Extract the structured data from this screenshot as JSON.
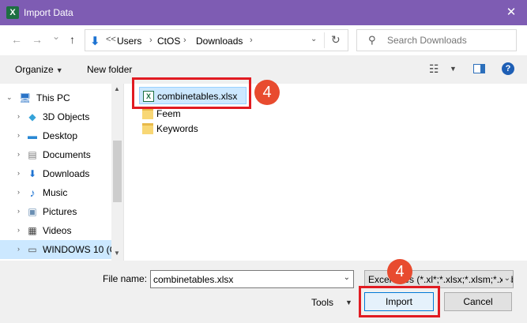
{
  "window": {
    "title": "Import Data",
    "app_icon": "excel-icon",
    "close_glyph": "✕"
  },
  "nav": {
    "back_glyph": "←",
    "forward_glyph": "→",
    "recent_glyph": "⌄",
    "up_glyph": "↑",
    "address": {
      "overflow": "<<",
      "crumbs": [
        "Users",
        "CtOS",
        "Downloads"
      ],
      "separator": "›",
      "refresh_glyph": "↻"
    },
    "search": {
      "placeholder": "Search Downloads",
      "icon": "search-icon"
    }
  },
  "toolbar": {
    "organize_label": "Organize",
    "new_folder_label": "New folder",
    "help_glyph": "?"
  },
  "sidebar": {
    "items": [
      {
        "label": "This PC",
        "icon": "computer-icon",
        "glyph": "🖥"
      },
      {
        "label": "3D Objects",
        "icon": "cube-icon",
        "glyph": "◆"
      },
      {
        "label": "Desktop",
        "icon": "desktop-icon",
        "glyph": "▬"
      },
      {
        "label": "Documents",
        "icon": "document-icon",
        "glyph": "▤"
      },
      {
        "label": "Downloads",
        "icon": "download-icon",
        "glyph": "⬇"
      },
      {
        "label": "Music",
        "icon": "music-icon",
        "glyph": "♪"
      },
      {
        "label": "Pictures",
        "icon": "picture-icon",
        "glyph": "▣"
      },
      {
        "label": "Videos",
        "icon": "video-icon",
        "glyph": "▦"
      },
      {
        "label": "WINDOWS 10 (C",
        "icon": "drive-icon",
        "glyph": "▭"
      }
    ]
  },
  "files": [
    {
      "name": "combinetables.xlsx",
      "type": "excel-file"
    },
    {
      "name": "Feem",
      "type": "folder"
    },
    {
      "name": "Keywords",
      "type": "folder"
    }
  ],
  "callouts": {
    "file_step": "4",
    "import_step": "4",
    "color": "#e11b22"
  },
  "bottom": {
    "filename_label": "File name:",
    "filename_value": "combinetables.xlsx",
    "filter_text": "Excel Files (*.xl*;*.xlsx;*.xlsm;*.xlsb;*.xlam)",
    "tools_label": "Tools",
    "import_label": "Import",
    "cancel_label": "Cancel"
  },
  "colors": {
    "titlebar": "#7e5cb3",
    "selection": "#cce8ff",
    "accent": "#0078d7"
  }
}
